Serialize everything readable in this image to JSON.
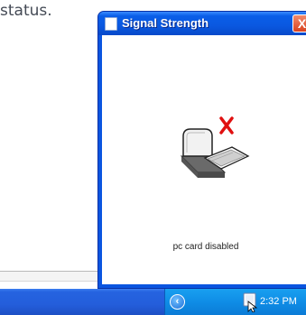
{
  "background": {
    "text": "status."
  },
  "window": {
    "title": "Signal Strength",
    "close_symbol": "X",
    "status_text": "pc card disabled",
    "icons": {
      "title_icon": "window-icon",
      "card": "pc-card-disabled-icon",
      "error": "red-x-icon"
    },
    "colors": {
      "title_bar": "#0a58e0",
      "close": "#d9421f",
      "error_x": "#e01010"
    }
  },
  "taskbar": {
    "tray_toggle_symbol": "‹",
    "tray_icon": "pc-card-tray-icon",
    "clock": "2:32 PM"
  }
}
